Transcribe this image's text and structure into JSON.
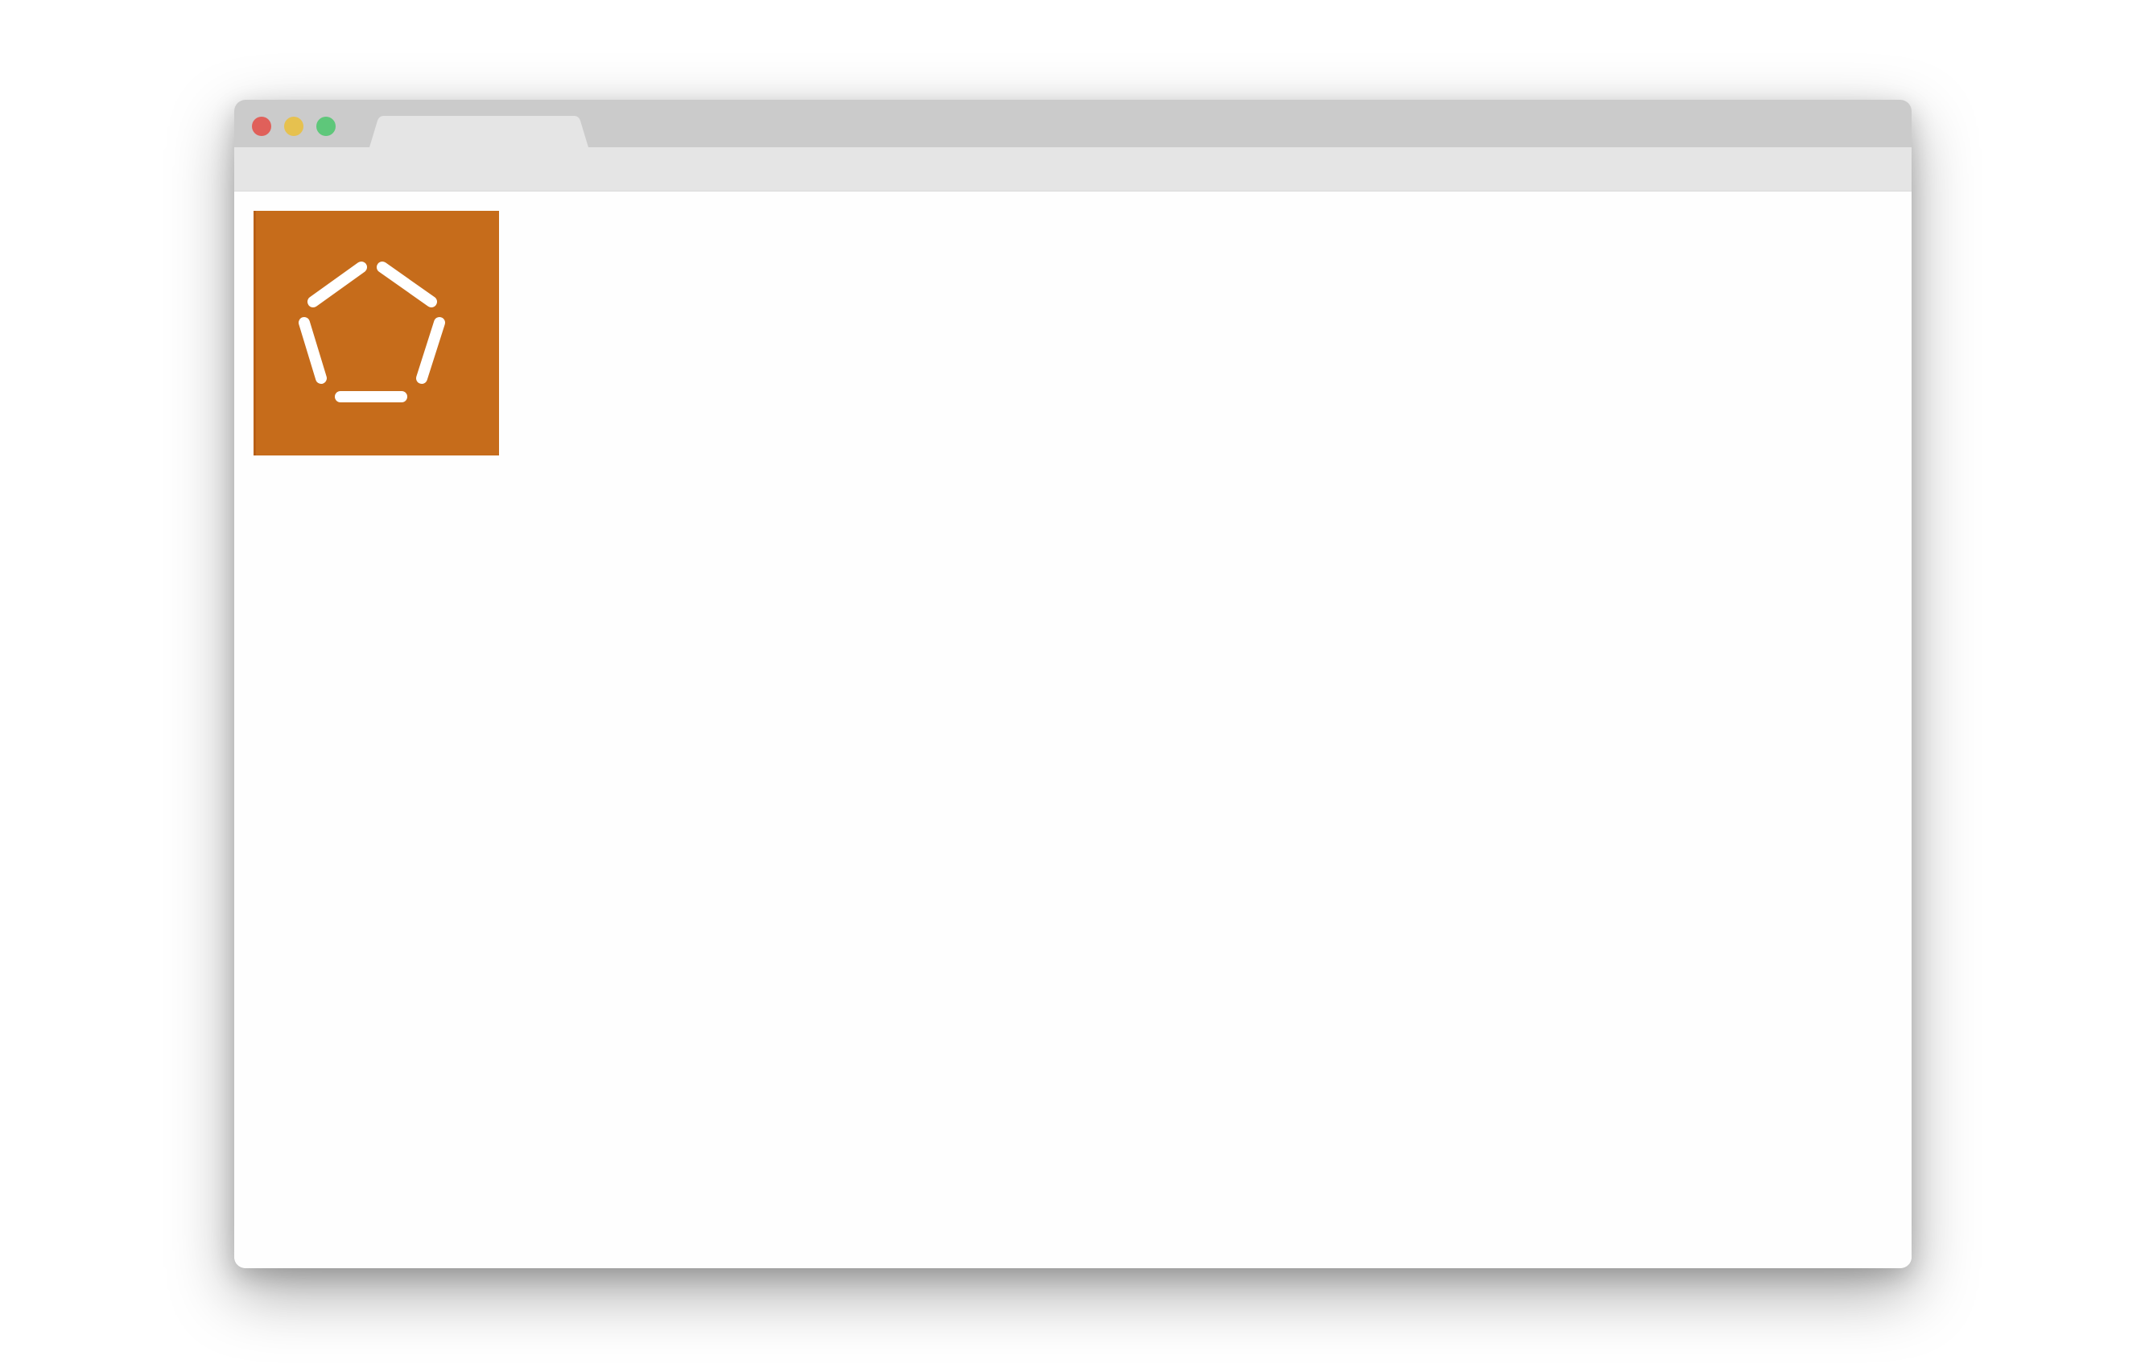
{
  "window": {
    "tab_title": "",
    "controls": [
      "close",
      "minimize",
      "maximize"
    ]
  },
  "content": {
    "logo": {
      "icon": "pentagon-icon",
      "background_color": "#c66c1b",
      "stroke_color": "#ffffff"
    }
  },
  "colors": {
    "close": "#e0605a",
    "minimize": "#e6c14f",
    "maximize": "#5ec77a",
    "titlebar": "#cbcbcb",
    "toolbar": "#e5e5e5",
    "tab": "#e5e5e5"
  }
}
